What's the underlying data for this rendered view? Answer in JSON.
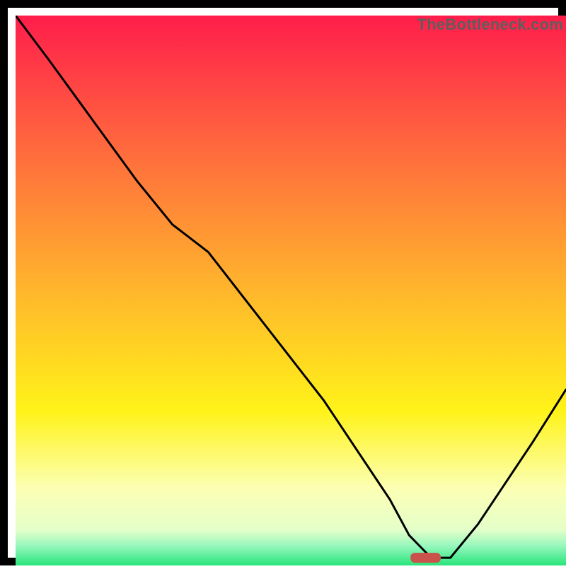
{
  "watermark": "TheBottleneck.com",
  "colors": {
    "frame": "#000000",
    "gradient_stops": [
      {
        "offset": 0.0,
        "color": "#ff1d4b"
      },
      {
        "offset": 0.25,
        "color": "#ff6c3d"
      },
      {
        "offset": 0.5,
        "color": "#ffb62c"
      },
      {
        "offset": 0.72,
        "color": "#fff319"
      },
      {
        "offset": 0.86,
        "color": "#fcffb4"
      },
      {
        "offset": 0.935,
        "color": "#e4ffc9"
      },
      {
        "offset": 0.965,
        "color": "#95f7bd"
      },
      {
        "offset": 1.0,
        "color": "#28e57a"
      }
    ],
    "curve": "#000000",
    "marker": "#c9534b"
  },
  "chart_data": {
    "type": "line",
    "title": "",
    "xlabel": "",
    "ylabel": "",
    "xlim": [
      0,
      100
    ],
    "ylim": [
      0,
      100
    ],
    "series": [
      {
        "name": "bottleneck-curve",
        "x": [
          0,
          6,
          14,
          22,
          28.5,
          35,
          42,
          49,
          56,
          62,
          68,
          71.5,
          75.5,
          79,
          84,
          89,
          94,
          100
        ],
        "y": [
          100,
          92,
          81,
          70,
          62,
          57,
          48,
          39,
          30,
          21,
          12,
          5.5,
          1.4,
          1.4,
          7.5,
          15,
          22.5,
          32
        ]
      }
    ],
    "marker": {
      "x": 74.5,
      "y": 1.4,
      "width": 5.5,
      "height": 1.8,
      "shape": "rounded-rect"
    }
  }
}
